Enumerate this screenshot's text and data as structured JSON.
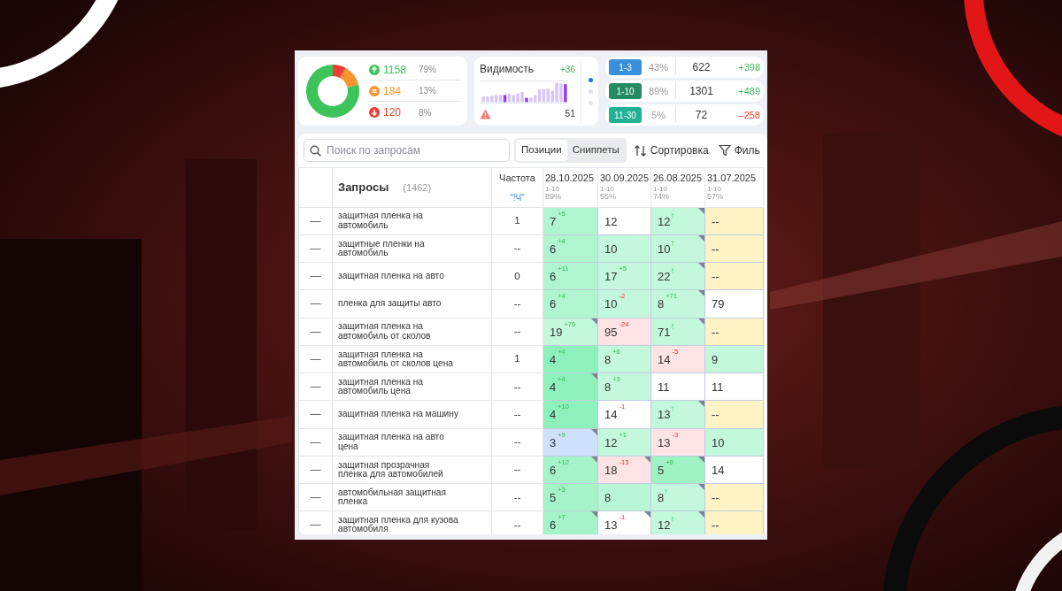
{
  "stats_card": {
    "chart_data": {
      "type": "donut",
      "values": [
        79,
        13,
        8
      ]
    },
    "items": [
      {
        "kind": "up",
        "count": "1158",
        "share": "79%",
        "color": "#3cc45a"
      },
      {
        "kind": "equal",
        "count": "184",
        "share": "13%",
        "color": "#f7962e"
      },
      {
        "kind": "down",
        "count": "120",
        "share": "8%",
        "color": "#ef3e36"
      }
    ]
  },
  "visibility_card": {
    "title": "Видимость",
    "change": "+36",
    "total": "51",
    "pages": [
      {
        "selected": true
      },
      {
        "selected": false
      },
      {
        "selected": false
      }
    ]
  },
  "ranges": [
    {
      "label": "1-3",
      "color": "#3a8fdc",
      "share": "43%",
      "count": "622",
      "change": "+398",
      "negative": false
    },
    {
      "label": "1-10",
      "color": "#268a63",
      "share": "89%",
      "count": "1301",
      "change": "+489",
      "negative": false
    },
    {
      "label": "11-30",
      "color": "#1fb394",
      "share": "5%",
      "count": "72",
      "change": "–258",
      "negative": true
    }
  ],
  "search": {
    "placeholder": "Поиск по запросам"
  },
  "view_tabs": [
    {
      "label": "Позиции",
      "selected": true
    },
    {
      "label": "Сниппеты",
      "selected": false
    }
  ],
  "toolbar_buttons": [
    {
      "kind": "sort",
      "label": "Сортировка"
    },
    {
      "kind": "filter",
      "label": "Филь"
    }
  ],
  "table": {
    "columns": {
      "query": "Запросы",
      "query_count": "(1462)",
      "frequency": "Частота",
      "frequency_type": "\"!Ч\"",
      "dates": [
        {
          "date": "28.10.2025",
          "range": "1-10",
          "share": "89%"
        },
        {
          "date": "30.09.2025",
          "range": "1-10",
          "share": "55%"
        },
        {
          "date": "26.08.2025",
          "range": "1-10",
          "share": "74%"
        },
        {
          "date": "31.07.2025",
          "range": "1-10",
          "share": "57%"
        }
      ]
    },
    "rows": [
      {
        "toggle": "—",
        "query": "защитная пленка на автомобиль",
        "frequency": "1",
        "cells": [
          {
            "value": "7",
            "change": "+5",
            "negative": false,
            "color": "#aef5d0",
            "flag": false
          },
          {
            "value": "12",
            "color": "#ffffff",
            "flag": false
          },
          {
            "value": "12",
            "change": "↑",
            "negative": false,
            "color": "#c3f8dc",
            "flag": true
          },
          {
            "value": "--",
            "color": "#fdf3c4",
            "flag": false
          }
        ]
      },
      {
        "toggle": "—",
        "query": "защитные пленки на автомобиль",
        "frequency": "--",
        "cells": [
          {
            "value": "6",
            "change": "+4",
            "negative": false,
            "color": "#aef5d0",
            "flag": false
          },
          {
            "value": "10",
            "color": "#c3f8dc",
            "flag": false
          },
          {
            "value": "10",
            "change": "↑",
            "negative": false,
            "color": "#c3f8dc",
            "flag": true
          },
          {
            "value": "--",
            "color": "#fdf3c4",
            "flag": false
          }
        ]
      },
      {
        "toggle": "—",
        "query": "защитная пленка на авто",
        "frequency": "0",
        "cells": [
          {
            "value": "6",
            "change": "+11",
            "negative": false,
            "color": "#aef5d0",
            "flag": false
          },
          {
            "value": "17",
            "change": "+5",
            "negative": false,
            "color": "#c3f8dc",
            "flag": false
          },
          {
            "value": "22",
            "change": "↑",
            "negative": false,
            "color": "#c3f8dc",
            "flag": true
          },
          {
            "value": "--",
            "color": "#fdf3c4",
            "flag": false
          }
        ]
      },
      {
        "toggle": "—",
        "query": "пленка для защиты авто",
        "frequency": "--",
        "cells": [
          {
            "value": "6",
            "change": "+4",
            "negative": false,
            "color": "#aef5d0",
            "flag": false
          },
          {
            "value": "10",
            "change": "-2",
            "negative": true,
            "color": "#c3f8dc",
            "flag": false
          },
          {
            "value": "8",
            "change": "+71",
            "negative": false,
            "color": "#c3f8dc",
            "flag": true
          },
          {
            "value": "79",
            "color": "#ffffff",
            "flag": false
          }
        ]
      },
      {
        "toggle": "—",
        "query": "защитная пленка на автомобиль от сколов",
        "frequency": "--",
        "cells": [
          {
            "value": "19",
            "change": "+76",
            "negative": false,
            "color": "#c3f8dc",
            "flag": true
          },
          {
            "value": "95",
            "change": "-24",
            "negative": true,
            "color": "#fde3e3",
            "flag": false
          },
          {
            "value": "71",
            "change": "↑",
            "negative": false,
            "color": "#c3f8dc",
            "flag": true
          },
          {
            "value": "--",
            "color": "#fdf3c4",
            "flag": false
          }
        ]
      },
      {
        "toggle": "—",
        "query": "защитная пленка на автомобиль от сколов цена",
        "frequency": "1",
        "cells": [
          {
            "value": "4",
            "change": "+4",
            "negative": false,
            "color": "#8ef0bb",
            "flag": false
          },
          {
            "value": "8",
            "change": "+6",
            "negative": false,
            "color": "#c3f8dc",
            "flag": false
          },
          {
            "value": "14",
            "change": "-5",
            "negative": true,
            "color": "#fde3e3",
            "flag": false
          },
          {
            "value": "9",
            "color": "#c3f8dc",
            "flag": false
          }
        ]
      },
      {
        "toggle": "—",
        "query": "защитная пленка на автомобиль цена",
        "frequency": "--",
        "cells": [
          {
            "value": "4",
            "change": "+4",
            "negative": false,
            "color": "#8ef0bb",
            "flag": true
          },
          {
            "value": "8",
            "change": "+3",
            "negative": false,
            "color": "#c3f8dc",
            "flag": false
          },
          {
            "value": "11",
            "color": "#ffffff",
            "flag": false
          },
          {
            "value": "11",
            "color": "#ffffff",
            "flag": false
          }
        ]
      },
      {
        "toggle": "—",
        "query": "защитная пленка на машину",
        "frequency": "--",
        "cells": [
          {
            "value": "4",
            "change": "+10",
            "negative": false,
            "color": "#8ef0bb",
            "flag": false
          },
          {
            "value": "14",
            "change": "-1",
            "negative": true,
            "color": "#ffffff",
            "flag": false
          },
          {
            "value": "13",
            "change": "↑",
            "negative": false,
            "color": "#c3f8dc",
            "flag": true
          },
          {
            "value": "--",
            "color": "#fdf3c4",
            "flag": false
          }
        ]
      },
      {
        "toggle": "—",
        "query": "защитная пленка на авто цена",
        "frequency": "--",
        "cells": [
          {
            "value": "3",
            "change": "+9",
            "negative": false,
            "color": "#cfe0fb",
            "flag": true
          },
          {
            "value": "12",
            "change": "+1",
            "negative": false,
            "color": "#c3f8dc",
            "flag": false
          },
          {
            "value": "13",
            "change": "-3",
            "negative": true,
            "color": "#fde3e3",
            "flag": false
          },
          {
            "value": "10",
            "color": "#c3f8dc",
            "flag": false
          }
        ]
      },
      {
        "toggle": "—",
        "query": "защитная прозрачная пленка для автомобилей",
        "frequency": "--",
        "cells": [
          {
            "value": "6",
            "change": "+12",
            "negative": false,
            "color": "#a5f3c8",
            "flag": true
          },
          {
            "value": "18",
            "change": "-13",
            "negative": true,
            "color": "#fde3e3",
            "flag": true
          },
          {
            "value": "5",
            "change": "+9",
            "negative": false,
            "color": "#9ef2c3",
            "flag": true
          },
          {
            "value": "14",
            "color": "#ffffff",
            "flag": false
          }
        ]
      },
      {
        "toggle": "—",
        "query": "автомобильная защитная пленка",
        "frequency": "--",
        "cells": [
          {
            "value": "5",
            "change": "+3",
            "negative": false,
            "color": "#a5f3c8",
            "flag": false
          },
          {
            "value": "8",
            "color": "#b8f6d5",
            "flag": false
          },
          {
            "value": "8",
            "change": "↑",
            "negative": false,
            "color": "#c3f8dc",
            "flag": true
          },
          {
            "value": "--",
            "color": "#fdf3c4",
            "flag": false
          }
        ]
      },
      {
        "toggle": "—",
        "query": "защитная пленка для кузова автомобиля",
        "frequency": "--",
        "cells": [
          {
            "value": "6",
            "change": "+7",
            "negative": false,
            "color": "#a5f3c8",
            "flag": true
          },
          {
            "value": "13",
            "change": "-1",
            "negative": true,
            "color": "#ffffff",
            "flag": true
          },
          {
            "value": "12",
            "change": "↑",
            "negative": false,
            "color": "#c3f8dc",
            "flag": true
          },
          {
            "value": "--",
            "color": "#fdf3c4",
            "flag": false
          }
        ]
      }
    ]
  }
}
